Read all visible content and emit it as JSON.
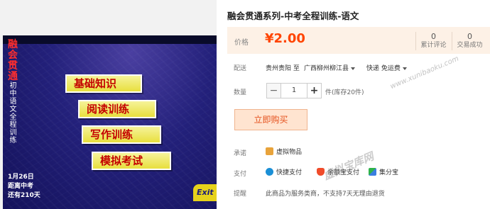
{
  "image": {
    "vertical_title": "融会贯通",
    "vertical_subtitle": "初中语文全程训练",
    "cards": [
      "基础知识",
      "阅读训练",
      "写作训练",
      "模拟考试"
    ],
    "date_lines": [
      "1月26日",
      "距离中考",
      "还有210天"
    ],
    "exit_label": "Exit"
  },
  "product": {
    "title": "融会贯通系列-中考全程训练-语文",
    "price_label": "价格",
    "price": "¥2.00",
    "stats": [
      {
        "value": "0",
        "label": "累计评论"
      },
      {
        "value": "0",
        "label": "交易成功"
      }
    ]
  },
  "shipping": {
    "label": "配送",
    "from": "贵州贵阳",
    "to_word": "至",
    "destination": "广西柳州柳江县",
    "method": "快递 免运费"
  },
  "quantity": {
    "label": "数量",
    "minus": "−",
    "value": "1",
    "plus": "+",
    "stock": "件(库存20件)"
  },
  "buy_button": "立即购买",
  "promise": {
    "label": "承诺",
    "item": "虚拟物品"
  },
  "payment": {
    "label": "支付",
    "methods": [
      "快捷支付",
      "余额宝支付",
      "集分宝"
    ]
  },
  "notice": {
    "label": "提醒",
    "text": "此商品为服务类商，不支持7天无理由退货"
  },
  "watermark": {
    "url": "www.xunibaoku.com",
    "name": "虚拟宝库网"
  },
  "colors": {
    "price": "#ff4400",
    "price_bg": "#fdf1e6",
    "buy_bg": "#ffe4d0",
    "buy_text": "#e5511d",
    "card_text": "#c40000",
    "card_bg": "#ece240",
    "image_bg": "#23207a"
  },
  "icons": {
    "promise": "gift-icon",
    "pay_quick": "shield-pay-icon",
    "pay_balance": "balance-bag-icon",
    "pay_points": "points-icon"
  }
}
